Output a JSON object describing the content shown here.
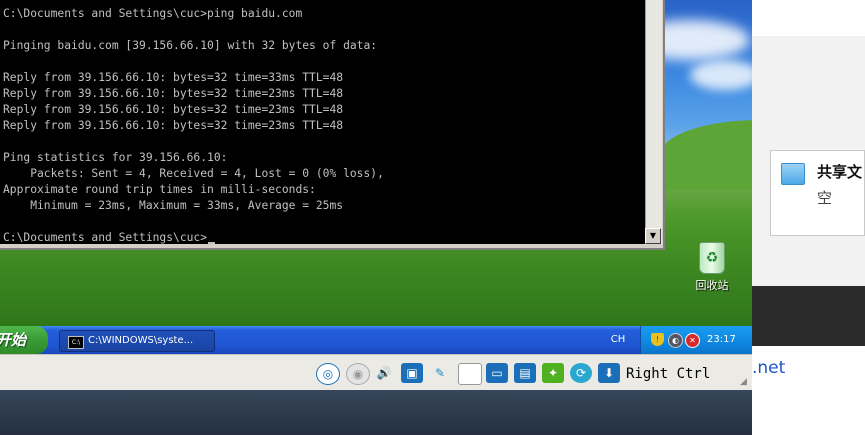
{
  "console": {
    "lines": [
      "C:\\Documents and Settings\\cuc>ping baidu.com",
      "",
      "Pinging baidu.com [39.156.66.10] with 32 bytes of data:",
      "",
      "Reply from 39.156.66.10: bytes=32 time=33ms TTL=48",
      "Reply from 39.156.66.10: bytes=32 time=23ms TTL=48",
      "Reply from 39.156.66.10: bytes=32 time=23ms TTL=48",
      "Reply from 39.156.66.10: bytes=32 time=23ms TTL=48",
      "",
      "Ping statistics for 39.156.66.10:",
      "    Packets: Sent = 4, Received = 4, Lost = 0 (0% loss),",
      "Approximate round trip times in milli-seconds:",
      "    Minimum = 23ms, Maximum = 33ms, Average = 25ms",
      "",
      "C:\\Documents and Settings\\cuc>"
    ],
    "scroll_down_glyph": "▼"
  },
  "desktop": {
    "recycle_bin_label": "回收站",
    "recycle_bin_icon": "recycle-bin-icon"
  },
  "taskbar": {
    "start_label": "开始",
    "task_button_icon": "C:\\",
    "task_button_label": "C:\\WINDOWS\\syste...",
    "language": "CH",
    "clock": "23:17",
    "tray_icons": [
      "shield-icon",
      "network-icon",
      "security-alert-icon"
    ]
  },
  "vbox_status": {
    "host_key_label": "Right Ctrl",
    "icons": [
      "hard-disk-icon",
      "optical-drive-icon",
      "audio-icon",
      "network-adapter-icon",
      "usb-icon",
      "shared-folders-icon",
      "display-icon",
      "video-capture-icon",
      "mouse-integration-icon",
      "keyboard-capture-icon",
      "download-icon"
    ]
  },
  "host": {
    "share_title": "共享文",
    "share_subtitle": "空",
    "link_fragment": ".net"
  },
  "colors": {
    "console_bg": "#000000",
    "console_fg": "#c0c0c0",
    "taskbar_blue": "#245edb",
    "start_green": "#3a9b36",
    "tray_blue": "#0e87e0"
  }
}
